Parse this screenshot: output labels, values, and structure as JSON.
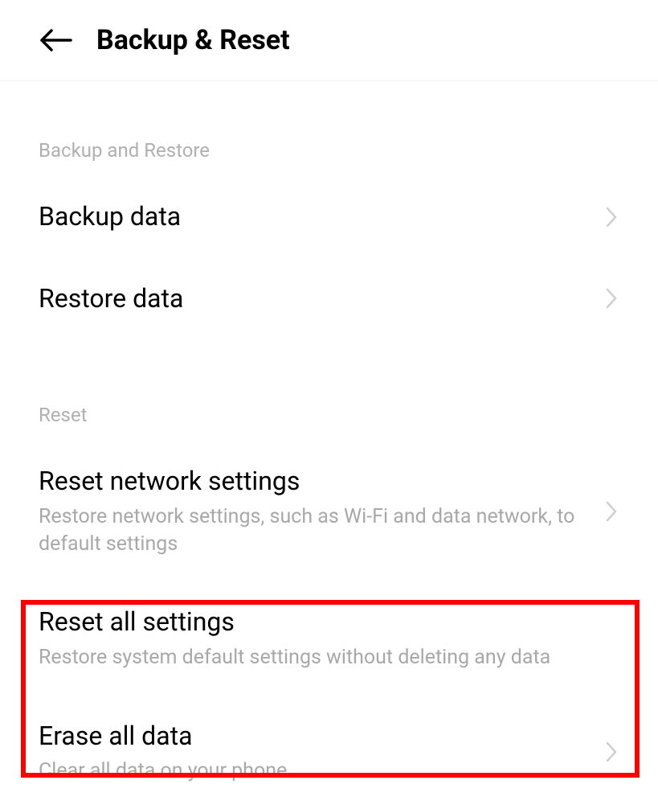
{
  "header": {
    "title": "Backup & Reset"
  },
  "sections": {
    "backup": {
      "label": "Backup and Restore",
      "items": {
        "backup_data": {
          "title": "Backup data"
        },
        "restore_data": {
          "title": "Restore data"
        }
      }
    },
    "reset": {
      "label": "Reset",
      "items": {
        "reset_network": {
          "title": "Reset network settings",
          "subtitle": "Restore network settings, such as Wi-Fi and data network, to default settings"
        },
        "reset_all": {
          "title": "Reset all settings",
          "subtitle": "Restore system default settings without deleting any data"
        },
        "erase_all": {
          "title": "Erase all data",
          "subtitle": "Clear all data on your phone"
        }
      }
    }
  }
}
